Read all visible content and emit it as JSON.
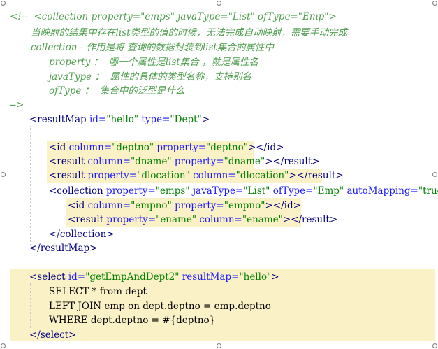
{
  "comment": {
    "open": "<!--  <collection property=\"emps\" javaType=\"List\" ofType=\"Emp\">",
    "line1": "当映射的结果中存在list类型的值的时候，无法完成自动映射，需要手动完成",
    "line2": "collection - 作用是将 查询的数据封装到list集合的属性中",
    "line3": "property ：  哪一个属性是list集合 ，就是属性名",
    "line4": "javaType ：  属性的具体的类型名称，支持别名",
    "line5": "ofType ：  集合中的泛型是什么",
    "close": "-->"
  },
  "resultMap": {
    "id": "hello",
    "type": "Dept",
    "id_row": {
      "column": "deptno",
      "property": "deptno"
    },
    "result1": {
      "column": "dname",
      "property": "dname"
    },
    "result2": {
      "property": "dlocation",
      "column": "dlocation"
    },
    "collection": {
      "property": "emps",
      "javaType": "List",
      "ofType": "Emp",
      "autoMapping": "true"
    },
    "coll_id": {
      "column": "empno",
      "property": "empno"
    },
    "coll_result": {
      "property": "ename",
      "column": "ename"
    }
  },
  "select": {
    "id": "getEmpAndDept2",
    "resultMap": "hello",
    "sql1": "SELECT * from dept",
    "sql2": "LEFT JOIN emp on dept.deptno = emp.deptno",
    "sql3": "WHERE dept.deptno = #{deptno}"
  }
}
